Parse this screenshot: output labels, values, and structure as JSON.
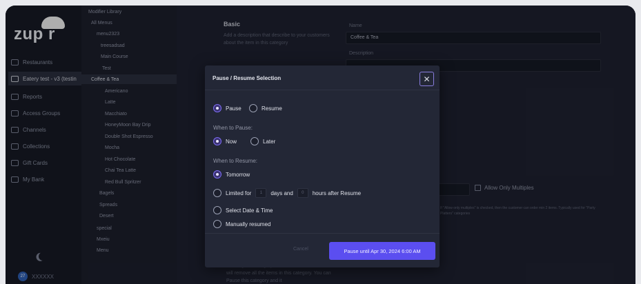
{
  "logo": {
    "text": "zup   r"
  },
  "nav": {
    "items": [
      {
        "label": "Restaurants",
        "icon": "fork-knife-icon"
      },
      {
        "label": "Eatery test - v3 (testin",
        "icon": "home-icon"
      },
      {
        "label": "Reports",
        "icon": "report-icon"
      },
      {
        "label": "Access Groups",
        "icon": "users-icon"
      },
      {
        "label": "Channels",
        "icon": "channel-icon"
      },
      {
        "label": "Collections",
        "icon": "collection-icon"
      },
      {
        "label": "Gift Cards",
        "icon": "gift-card-icon"
      },
      {
        "label": "My Bank",
        "icon": "bank-icon"
      }
    ],
    "user": {
      "avatar": "27",
      "name": "XXXXXX"
    }
  },
  "tree": {
    "items": [
      "Modifier Library",
      "All Menus",
      "menu2323",
      "treesadsad",
      "Main Course",
      "Test",
      "Coffee & Tea",
      "Americano",
      "Latte",
      "Macchiato",
      "HoneyMoon Bay Drip",
      "Double Shot Espresso",
      "Mocha",
      "Hot Chocolate",
      "Chai Tea Latte",
      "Red Bull Spritzer",
      "Bagels",
      "Spreads",
      "Desert",
      "special",
      "Mxeiu",
      "Menu"
    ]
  },
  "main": {
    "section_title": "Basic",
    "section_desc": "Add a description that describe to your customers about the item in this category",
    "name_label": "Name",
    "name_value": "Coffee & Tea",
    "description_label": "Description",
    "allow_multiples": "Allow Only Multiples",
    "allow_note": "If \"Allow only multiples\" is checked, then the customer can order min 2 items. Typically used for \"Party Platters\" categories",
    "delete_desc": "Deleting this category is an irrecoverable action and will remove all the items in this category. You can Pause this category and it"
  },
  "modal": {
    "title": "Pause / Resume Selection",
    "close_icon": "close-icon",
    "mode": {
      "pause": "Pause",
      "resume": "Resume",
      "selected": "Pause"
    },
    "when_to_pause": {
      "label": "When to Pause:",
      "now": "Now",
      "later": "Later",
      "selected": "Now"
    },
    "when_to_resume": {
      "label": "When to Resume:",
      "tomorrow": "Tomorrow",
      "limited_for": "Limited for",
      "days_value": "1",
      "days_and": "days and",
      "hours_value": "0",
      "hours_after": "hours after Resume",
      "select_date": "Select Date & Time",
      "manual": "Manually resumed",
      "selected": "Tomorrow"
    },
    "cancel_label": "Cancel",
    "primary_label": "Pause until Apr 30, 2024 6:00 AM"
  },
  "colors": {
    "accent": "#5b4ef0",
    "background": "#1a1d29"
  }
}
